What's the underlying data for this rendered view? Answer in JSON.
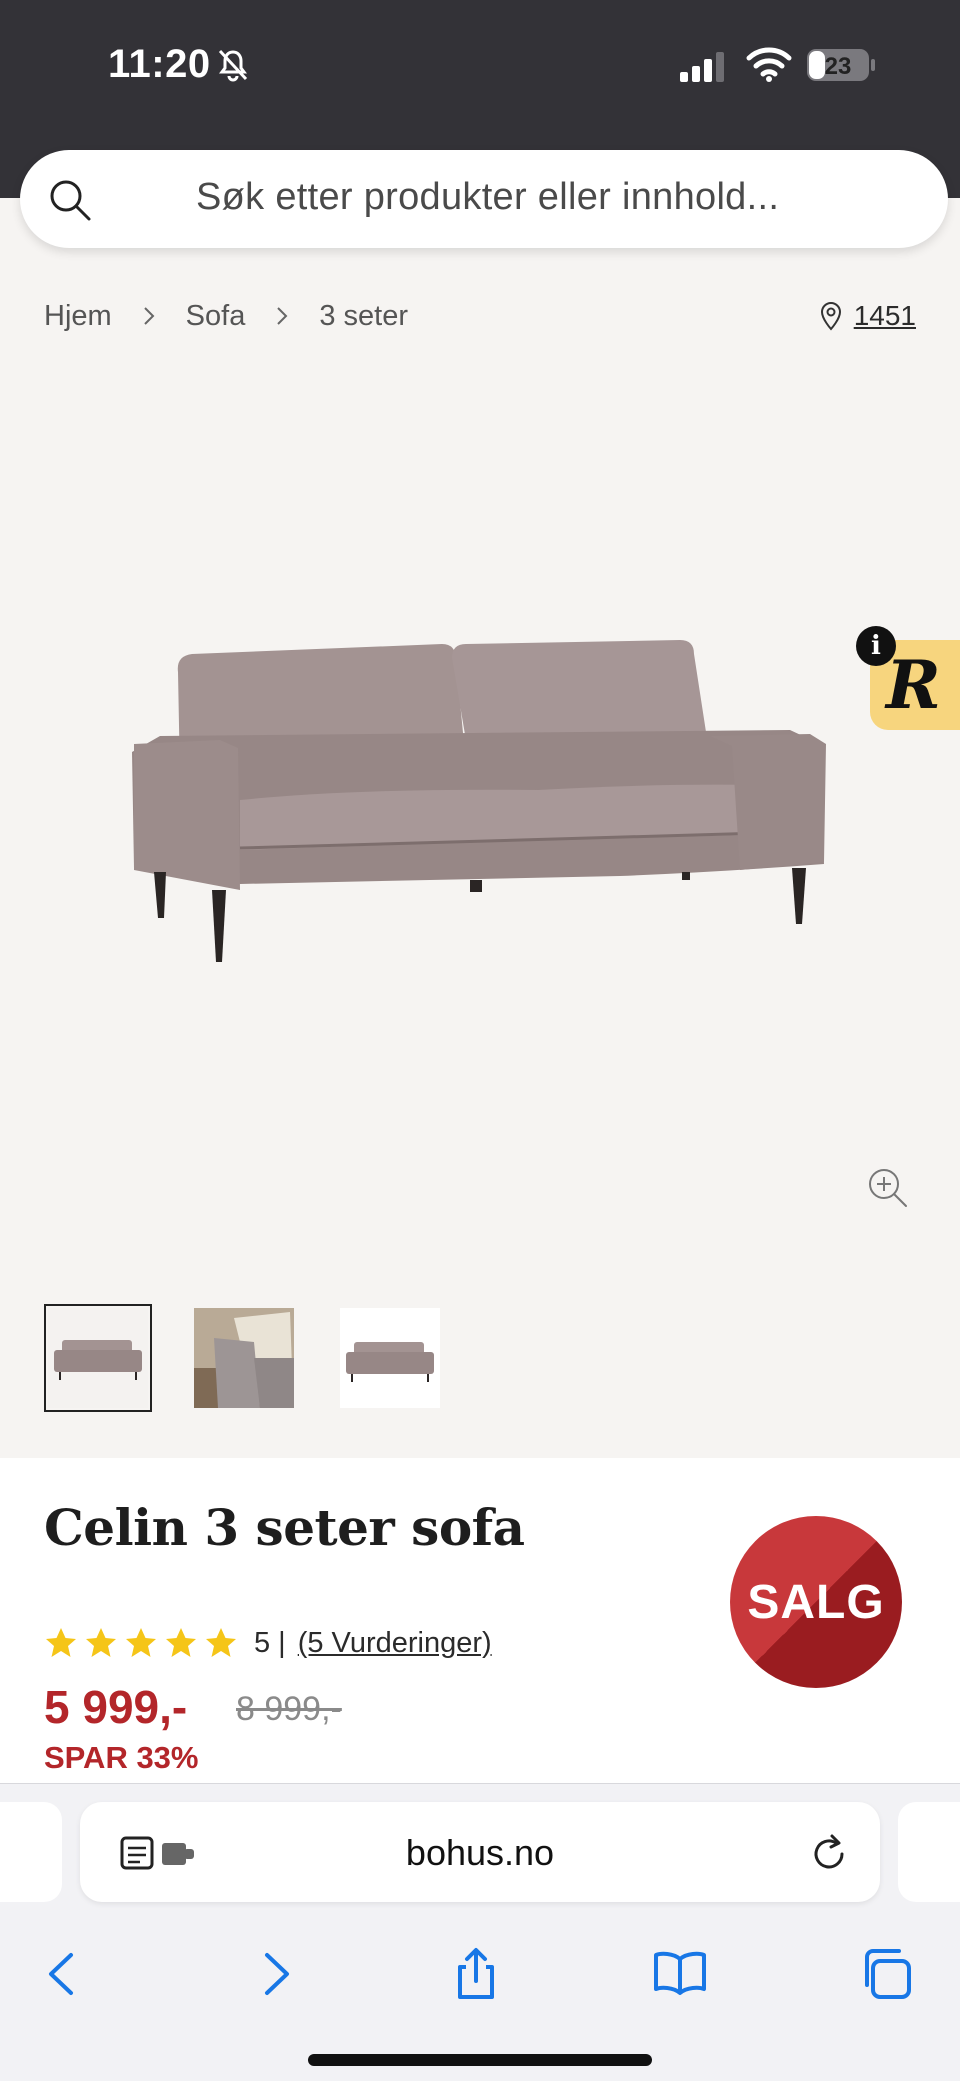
{
  "status_bar": {
    "time": "11:20",
    "battery": "23",
    "icons": [
      "bell-slash-icon",
      "signal-icon",
      "wifi-icon",
      "battery-icon"
    ]
  },
  "search": {
    "placeholder": "Søk etter produkter eller innhold..."
  },
  "breadcrumb": {
    "items": [
      "Hjem",
      "Sofa",
      "3 seter"
    ]
  },
  "store_location": {
    "code": "1451"
  },
  "product": {
    "title": "Celin 3 seter sofa",
    "rating_value": "5 |",
    "rating_count_label": "(5 Vurderinger)",
    "stars": 5,
    "price_now": "5 999,-",
    "price_old": "8 999,-",
    "save_label": "SPAR 33%",
    "sale_badge": "SALG",
    "thumbnail_count": 3
  },
  "widget": {
    "info_label": "i",
    "letter": "R"
  },
  "browser": {
    "address": "bohus.no"
  },
  "colors": {
    "accent_red": "#b3262a",
    "star_yellow": "#f5c518",
    "sofa": "#9f8f8e",
    "badge_yellow": "#f7d57e",
    "ios_blue": "#1877e6"
  }
}
